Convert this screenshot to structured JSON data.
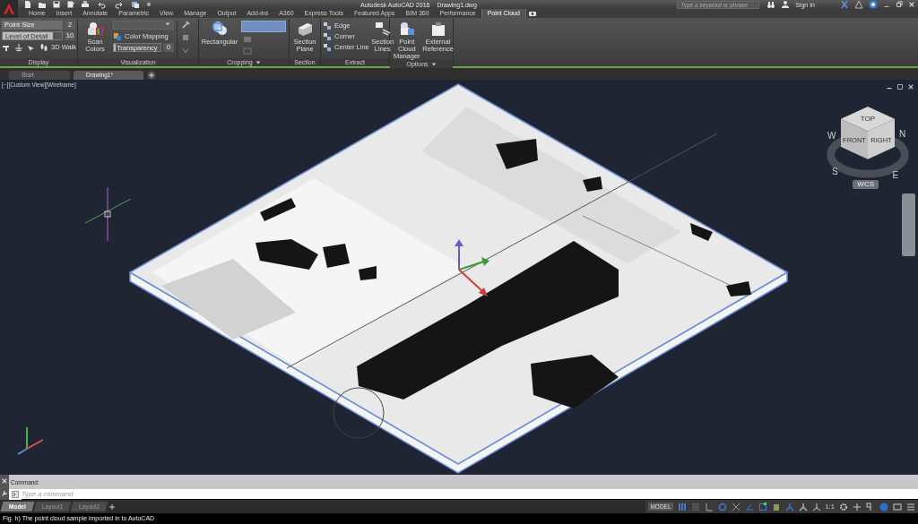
{
  "window": {
    "title": "Autodesk AutoCAD 2016",
    "document": "Drawing1.dwg"
  },
  "search": {
    "placeholder": "Type a keyword or phrase"
  },
  "account": {
    "label": "Sign In"
  },
  "ribbon_tabs": [
    {
      "label": "Home",
      "selected": false
    },
    {
      "label": "Insert",
      "selected": false
    },
    {
      "label": "Annotate",
      "selected": false
    },
    {
      "label": "Parametric",
      "selected": false
    },
    {
      "label": "View",
      "selected": false
    },
    {
      "label": "Manage",
      "selected": false
    },
    {
      "label": "Output",
      "selected": false
    },
    {
      "label": "Add-ins",
      "selected": false
    },
    {
      "label": "A360",
      "selected": false
    },
    {
      "label": "Express Tools",
      "selected": false
    },
    {
      "label": "Featured Apps",
      "selected": false
    },
    {
      "label": "BIM 360",
      "selected": false
    },
    {
      "label": "Performance",
      "selected": false
    },
    {
      "label": "Point Cloud",
      "selected": true
    }
  ],
  "display": {
    "title": "Display",
    "point_size": {
      "label": "Point Size",
      "value": "2"
    },
    "level_of_detail": {
      "label": "Level of Detail",
      "value": "10",
      "level": 0.85
    },
    "walk": "3D Walk"
  },
  "visualization": {
    "title": "Visualization",
    "scan_colors": "Scan Colors",
    "color_mapping": "Color Mapping",
    "transparency": {
      "label": "Transparency",
      "value": "0",
      "level": 0.03
    }
  },
  "cropping": {
    "title": "Cropping",
    "rectangular": "Rectangular"
  },
  "section": {
    "title": "Section",
    "button": "Section Plane"
  },
  "extract": {
    "title": "Extract",
    "items": [
      "Edge",
      "Corner",
      "Center Line"
    ],
    "section_lines": "Section Lines"
  },
  "options": {
    "title": "Options",
    "buttons": [
      "Point Cloud Manager",
      "External Reference"
    ]
  },
  "file_tabs": [
    {
      "label": "Start",
      "selected": false
    },
    {
      "label": "Drawing1*",
      "selected": true
    }
  ],
  "viewport": {
    "label": "[−][Custom View][Wireframe]",
    "viewcube": {
      "top": "TOP",
      "front": "FRONT",
      "right": "RIGHT",
      "compass": {
        "n": "N",
        "e": "E",
        "s": "S",
        "w": "W"
      },
      "ucs": "WCS"
    }
  },
  "command": {
    "history": "Command:",
    "placeholder": "Type a command"
  },
  "layout_tabs": [
    {
      "label": "Model",
      "selected": true
    },
    {
      "label": "Layout1",
      "selected": false
    },
    {
      "label": "Layout2",
      "selected": false
    }
  ],
  "status_bar": {
    "model": "MODEL",
    "scale": "1:1"
  },
  "caption": "Fig. h) The point cloud sample imported in to AutoCAD"
}
